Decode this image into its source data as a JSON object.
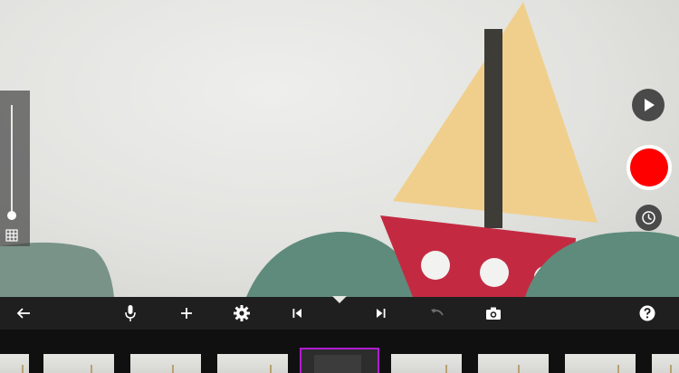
{
  "viewport": {
    "scene": "camera-preview"
  },
  "onion_skin": {
    "level": 1.0,
    "grid_icon": "grid-icon"
  },
  "controls": {
    "play_icon": "play-icon",
    "record_icon": "record-icon",
    "timer_icon": "timer-icon",
    "record_color": "#fe0000"
  },
  "toolbar": {
    "icons": [
      "back-arrow-icon",
      "microphone-icon",
      "add-icon",
      "settings-gear-icon",
      "skip-to-start-icon",
      "skip-to-end-icon",
      "undo-icon",
      "camera-icon",
      "help-icon"
    ]
  },
  "filmstrip": {
    "frame_count": 9,
    "selected_index": 4,
    "selection_color": "#b11bd3"
  }
}
